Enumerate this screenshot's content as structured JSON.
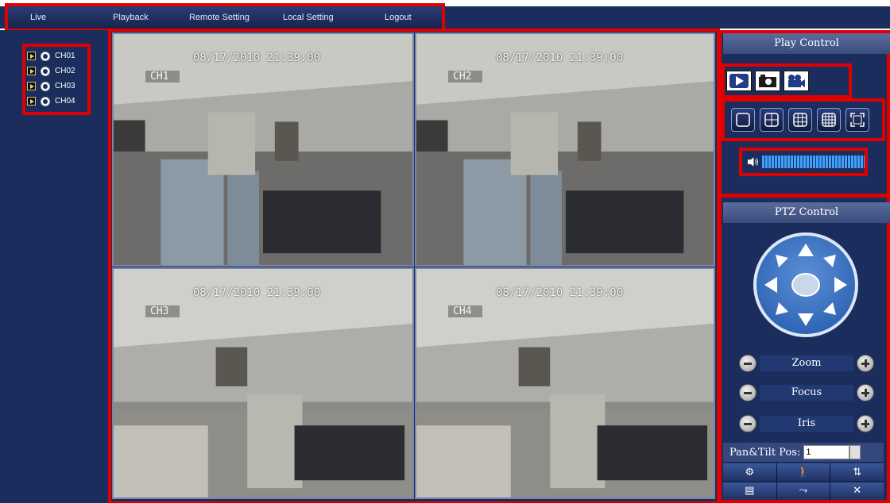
{
  "nav": {
    "items": [
      "Live",
      "Playback",
      "Remote Setting",
      "Local Setting",
      "Logout"
    ]
  },
  "channels": [
    "CH01",
    "CH02",
    "CH03",
    "CH04"
  ],
  "tiles": [
    {
      "timestamp": "08/17/2010 21:39:00",
      "channel": "CH1"
    },
    {
      "timestamp": "08/17/2010 21:39:00",
      "channel": "CH2"
    },
    {
      "timestamp": "08/17/2010 21:39:00",
      "channel": "CH3"
    },
    {
      "timestamp": "08/17/2010 21:39:00",
      "channel": "CH4"
    }
  ],
  "play_control": {
    "title": "Play Control"
  },
  "ptz_control": {
    "title": "PTZ Control",
    "zoom_label": "Zoom",
    "focus_label": "Focus",
    "iris_label": "Iris",
    "pantilt_label": "Pan&Tilt Pos:",
    "pantilt_value": "1"
  },
  "colors": {
    "highlight": "#e00000",
    "panel_bg": "#1b2d5c",
    "accent_blue": "#3ea2ff"
  }
}
